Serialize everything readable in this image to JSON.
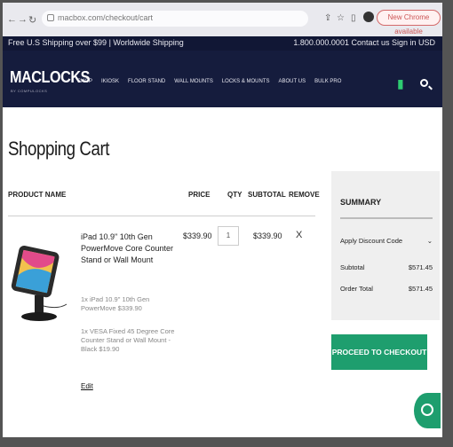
{
  "browser": {
    "url": "macbox.com/checkout/cart",
    "update_label": "New Chrome available"
  },
  "promo": {
    "left": "Free U.S Shipping over $99 | Worldwide Shipping",
    "right": "1.800.000.0001  Contact us  Sign in  USD"
  },
  "header": {
    "logo": "MACLOCKS",
    "logo_sub": "BY COMPULOCKS",
    "menu": [
      "SHOP",
      "IKIOSK",
      "FLOOR STAND",
      "WALL MOUNTS",
      "LOCKS & MOUNTS",
      "ABOUT US",
      "BULK PRO"
    ]
  },
  "page": {
    "title": "Shopping Cart"
  },
  "table": {
    "headers": [
      "PRODUCT NAME",
      "PRICE",
      "QTY",
      "SUBTOTAL",
      "REMOVE"
    ],
    "item": {
      "name": "iPad 10.9\" 10th Gen PowerMove Core Counter Stand or Wall Mount",
      "price": "$339.90",
      "qty": "1",
      "subtotal": "$339.90",
      "remove": "X",
      "option1": "1x iPad 10.9\" 10th Gen PowerMove $339.90",
      "option2": "1x VESA Fixed 45 Degree Core Counter Stand or Wall Mount - Black $19.90",
      "edit": "Edit"
    }
  },
  "summary": {
    "title": "SUMMARY",
    "discount": "Apply Discount Code",
    "subtotal_label": "Subtotal",
    "subtotal_value": "$571.45",
    "total_label": "Order Total",
    "total_value": "$571.45"
  },
  "checkout": {
    "label": "PROCEED TO CHECKOUT"
  },
  "colors": {
    "navbar": "#151c3d",
    "accent": "#1e9e6e"
  }
}
